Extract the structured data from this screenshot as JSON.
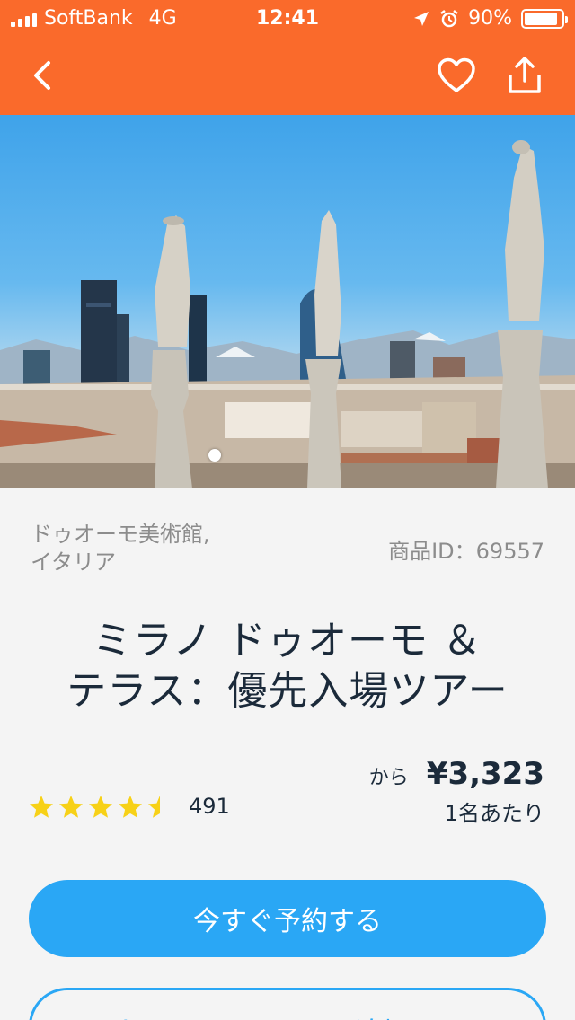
{
  "status_bar": {
    "carrier": "SoftBank",
    "network": "4G",
    "time": "12:41",
    "battery": "90%",
    "battery_level": 0.9
  },
  "nav": {
    "back_icon": "chevron-left-icon",
    "favorite_icon": "heart-icon",
    "share_icon": "share-icon"
  },
  "hero": {
    "image_description": "Milan Duomo rooftop statues with city skyline",
    "pager_dots": 1
  },
  "product": {
    "location": "ドゥオーモ美術館, イタリア",
    "product_id": "商品ID：69557",
    "title": "ミラノ ドゥオーモ ＆ テラス：優先入場ツアー",
    "price_from": "から",
    "price": "¥3,323",
    "price_unit": "1名あたり",
    "rating": 4.5,
    "review_count": "491"
  },
  "actions": {
    "book_label": "今すぐ予約する",
    "wishlist_label": "ウィッシュリストに追加する"
  },
  "colors": {
    "brand_orange": "#fa6a2b",
    "accent_blue": "#2aa7f5",
    "star_yellow": "#f7d117",
    "text_dark": "#1b2a3a"
  }
}
